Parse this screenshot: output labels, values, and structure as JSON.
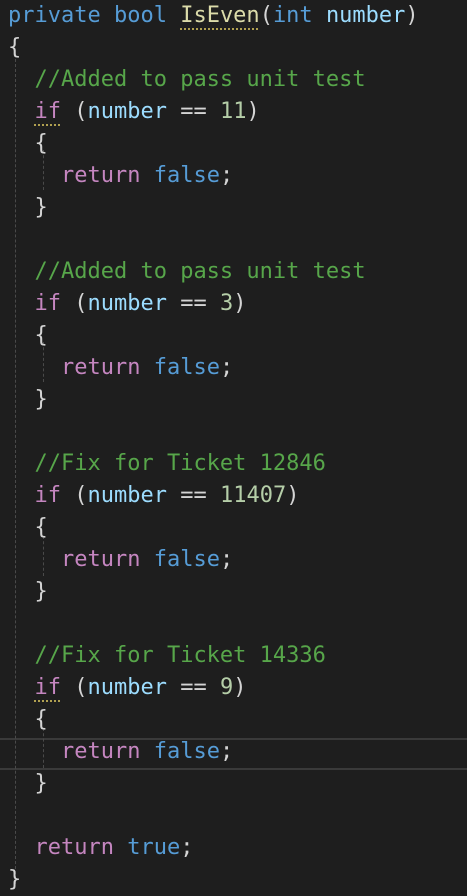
{
  "colors": {
    "background": "#1e1e1e",
    "keyword": "#569cd6",
    "control": "#c586c0",
    "method": "#dcdcaa",
    "parameter": "#9cdcfe",
    "comment": "#57a64a",
    "number": "#b5cea8",
    "plain": "#d4d4d4"
  },
  "editor": {
    "lines": [
      [
        {
          "t": "private",
          "c": "keyword"
        },
        {
          "t": " "
        },
        {
          "t": "bool",
          "c": "keyword"
        },
        {
          "t": " "
        },
        {
          "t": "IsEven",
          "c": "method",
          "u": true
        },
        {
          "t": "("
        },
        {
          "t": "int",
          "c": "keyword"
        },
        {
          "t": " "
        },
        {
          "t": "number",
          "c": "parameter"
        },
        {
          "t": ")"
        }
      ],
      [
        {
          "t": "{"
        }
      ],
      [
        {
          "t": "  "
        },
        {
          "t": "//Added to pass unit test",
          "c": "comment"
        }
      ],
      [
        {
          "t": "  "
        },
        {
          "t": "if",
          "c": "control",
          "u": true
        },
        {
          "t": " ("
        },
        {
          "t": "number",
          "c": "parameter"
        },
        {
          "t": " == "
        },
        {
          "t": "11",
          "c": "number"
        },
        {
          "t": ")"
        }
      ],
      [
        {
          "t": "  {"
        }
      ],
      [
        {
          "t": "    "
        },
        {
          "t": "return",
          "c": "control"
        },
        {
          "t": " "
        },
        {
          "t": "false",
          "c": "keyword"
        },
        {
          "t": ";"
        }
      ],
      [
        {
          "t": "  }"
        }
      ],
      [],
      [
        {
          "t": "  "
        },
        {
          "t": "//Added to pass unit test",
          "c": "comment"
        }
      ],
      [
        {
          "t": "  "
        },
        {
          "t": "if",
          "c": "control"
        },
        {
          "t": " ("
        },
        {
          "t": "number",
          "c": "parameter"
        },
        {
          "t": " == "
        },
        {
          "t": "3",
          "c": "number"
        },
        {
          "t": ")"
        }
      ],
      [
        {
          "t": "  {"
        }
      ],
      [
        {
          "t": "    "
        },
        {
          "t": "return",
          "c": "control"
        },
        {
          "t": " "
        },
        {
          "t": "false",
          "c": "keyword"
        },
        {
          "t": ";"
        }
      ],
      [
        {
          "t": "  }"
        }
      ],
      [],
      [
        {
          "t": "  "
        },
        {
          "t": "//Fix for Ticket 12846",
          "c": "comment"
        }
      ],
      [
        {
          "t": "  "
        },
        {
          "t": "if",
          "c": "control"
        },
        {
          "t": " ("
        },
        {
          "t": "number",
          "c": "parameter"
        },
        {
          "t": " == "
        },
        {
          "t": "11407",
          "c": "number"
        },
        {
          "t": ")"
        }
      ],
      [
        {
          "t": "  {"
        }
      ],
      [
        {
          "t": "    "
        },
        {
          "t": "return",
          "c": "control"
        },
        {
          "t": " "
        },
        {
          "t": "false",
          "c": "keyword"
        },
        {
          "t": ";"
        }
      ],
      [
        {
          "t": "  }"
        }
      ],
      [],
      [
        {
          "t": "  "
        },
        {
          "t": "//Fix for Ticket 14336",
          "c": "comment"
        }
      ],
      [
        {
          "t": "  "
        },
        {
          "t": "if",
          "c": "control",
          "u": true
        },
        {
          "t": " ("
        },
        {
          "t": "number",
          "c": "parameter"
        },
        {
          "t": " == "
        },
        {
          "t": "9",
          "c": "number"
        },
        {
          "t": ")"
        }
      ],
      [
        {
          "t": "  {"
        }
      ],
      [
        {
          "t": "    "
        },
        {
          "t": "return",
          "c": "control"
        },
        {
          "t": " "
        },
        {
          "t": "false",
          "c": "keyword"
        },
        {
          "t": ";"
        }
      ],
      [
        {
          "t": "  }"
        }
      ],
      [],
      [
        {
          "t": "  "
        },
        {
          "t": "return",
          "c": "control"
        },
        {
          "t": " "
        },
        {
          "t": "true",
          "c": "keyword"
        },
        {
          "t": ";"
        }
      ],
      [
        {
          "t": "}"
        }
      ]
    ]
  }
}
